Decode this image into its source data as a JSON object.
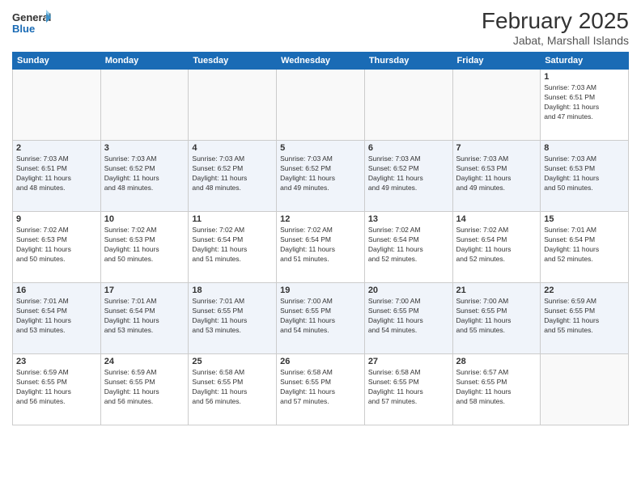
{
  "logo": {
    "general": "General",
    "blue": "Blue"
  },
  "header": {
    "month_year": "February 2025",
    "location": "Jabat, Marshall Islands"
  },
  "weekdays": [
    "Sunday",
    "Monday",
    "Tuesday",
    "Wednesday",
    "Thursday",
    "Friday",
    "Saturday"
  ],
  "weeks": [
    {
      "alt": false,
      "days": [
        {
          "num": "",
          "info": ""
        },
        {
          "num": "",
          "info": ""
        },
        {
          "num": "",
          "info": ""
        },
        {
          "num": "",
          "info": ""
        },
        {
          "num": "",
          "info": ""
        },
        {
          "num": "",
          "info": ""
        },
        {
          "num": "1",
          "info": "Sunrise: 7:03 AM\nSunset: 6:51 PM\nDaylight: 11 hours\nand 47 minutes."
        }
      ]
    },
    {
      "alt": true,
      "days": [
        {
          "num": "2",
          "info": "Sunrise: 7:03 AM\nSunset: 6:51 PM\nDaylight: 11 hours\nand 48 minutes."
        },
        {
          "num": "3",
          "info": "Sunrise: 7:03 AM\nSunset: 6:52 PM\nDaylight: 11 hours\nand 48 minutes."
        },
        {
          "num": "4",
          "info": "Sunrise: 7:03 AM\nSunset: 6:52 PM\nDaylight: 11 hours\nand 48 minutes."
        },
        {
          "num": "5",
          "info": "Sunrise: 7:03 AM\nSunset: 6:52 PM\nDaylight: 11 hours\nand 49 minutes."
        },
        {
          "num": "6",
          "info": "Sunrise: 7:03 AM\nSunset: 6:52 PM\nDaylight: 11 hours\nand 49 minutes."
        },
        {
          "num": "7",
          "info": "Sunrise: 7:03 AM\nSunset: 6:53 PM\nDaylight: 11 hours\nand 49 minutes."
        },
        {
          "num": "8",
          "info": "Sunrise: 7:03 AM\nSunset: 6:53 PM\nDaylight: 11 hours\nand 50 minutes."
        }
      ]
    },
    {
      "alt": false,
      "days": [
        {
          "num": "9",
          "info": "Sunrise: 7:02 AM\nSunset: 6:53 PM\nDaylight: 11 hours\nand 50 minutes."
        },
        {
          "num": "10",
          "info": "Sunrise: 7:02 AM\nSunset: 6:53 PM\nDaylight: 11 hours\nand 50 minutes."
        },
        {
          "num": "11",
          "info": "Sunrise: 7:02 AM\nSunset: 6:54 PM\nDaylight: 11 hours\nand 51 minutes."
        },
        {
          "num": "12",
          "info": "Sunrise: 7:02 AM\nSunset: 6:54 PM\nDaylight: 11 hours\nand 51 minutes."
        },
        {
          "num": "13",
          "info": "Sunrise: 7:02 AM\nSunset: 6:54 PM\nDaylight: 11 hours\nand 52 minutes."
        },
        {
          "num": "14",
          "info": "Sunrise: 7:02 AM\nSunset: 6:54 PM\nDaylight: 11 hours\nand 52 minutes."
        },
        {
          "num": "15",
          "info": "Sunrise: 7:01 AM\nSunset: 6:54 PM\nDaylight: 11 hours\nand 52 minutes."
        }
      ]
    },
    {
      "alt": true,
      "days": [
        {
          "num": "16",
          "info": "Sunrise: 7:01 AM\nSunset: 6:54 PM\nDaylight: 11 hours\nand 53 minutes."
        },
        {
          "num": "17",
          "info": "Sunrise: 7:01 AM\nSunset: 6:54 PM\nDaylight: 11 hours\nand 53 minutes."
        },
        {
          "num": "18",
          "info": "Sunrise: 7:01 AM\nSunset: 6:55 PM\nDaylight: 11 hours\nand 53 minutes."
        },
        {
          "num": "19",
          "info": "Sunrise: 7:00 AM\nSunset: 6:55 PM\nDaylight: 11 hours\nand 54 minutes."
        },
        {
          "num": "20",
          "info": "Sunrise: 7:00 AM\nSunset: 6:55 PM\nDaylight: 11 hours\nand 54 minutes."
        },
        {
          "num": "21",
          "info": "Sunrise: 7:00 AM\nSunset: 6:55 PM\nDaylight: 11 hours\nand 55 minutes."
        },
        {
          "num": "22",
          "info": "Sunrise: 6:59 AM\nSunset: 6:55 PM\nDaylight: 11 hours\nand 55 minutes."
        }
      ]
    },
    {
      "alt": false,
      "days": [
        {
          "num": "23",
          "info": "Sunrise: 6:59 AM\nSunset: 6:55 PM\nDaylight: 11 hours\nand 56 minutes."
        },
        {
          "num": "24",
          "info": "Sunrise: 6:59 AM\nSunset: 6:55 PM\nDaylight: 11 hours\nand 56 minutes."
        },
        {
          "num": "25",
          "info": "Sunrise: 6:58 AM\nSunset: 6:55 PM\nDaylight: 11 hours\nand 56 minutes."
        },
        {
          "num": "26",
          "info": "Sunrise: 6:58 AM\nSunset: 6:55 PM\nDaylight: 11 hours\nand 57 minutes."
        },
        {
          "num": "27",
          "info": "Sunrise: 6:58 AM\nSunset: 6:55 PM\nDaylight: 11 hours\nand 57 minutes."
        },
        {
          "num": "28",
          "info": "Sunrise: 6:57 AM\nSunset: 6:55 PM\nDaylight: 11 hours\nand 58 minutes."
        },
        {
          "num": "",
          "info": ""
        }
      ]
    }
  ]
}
